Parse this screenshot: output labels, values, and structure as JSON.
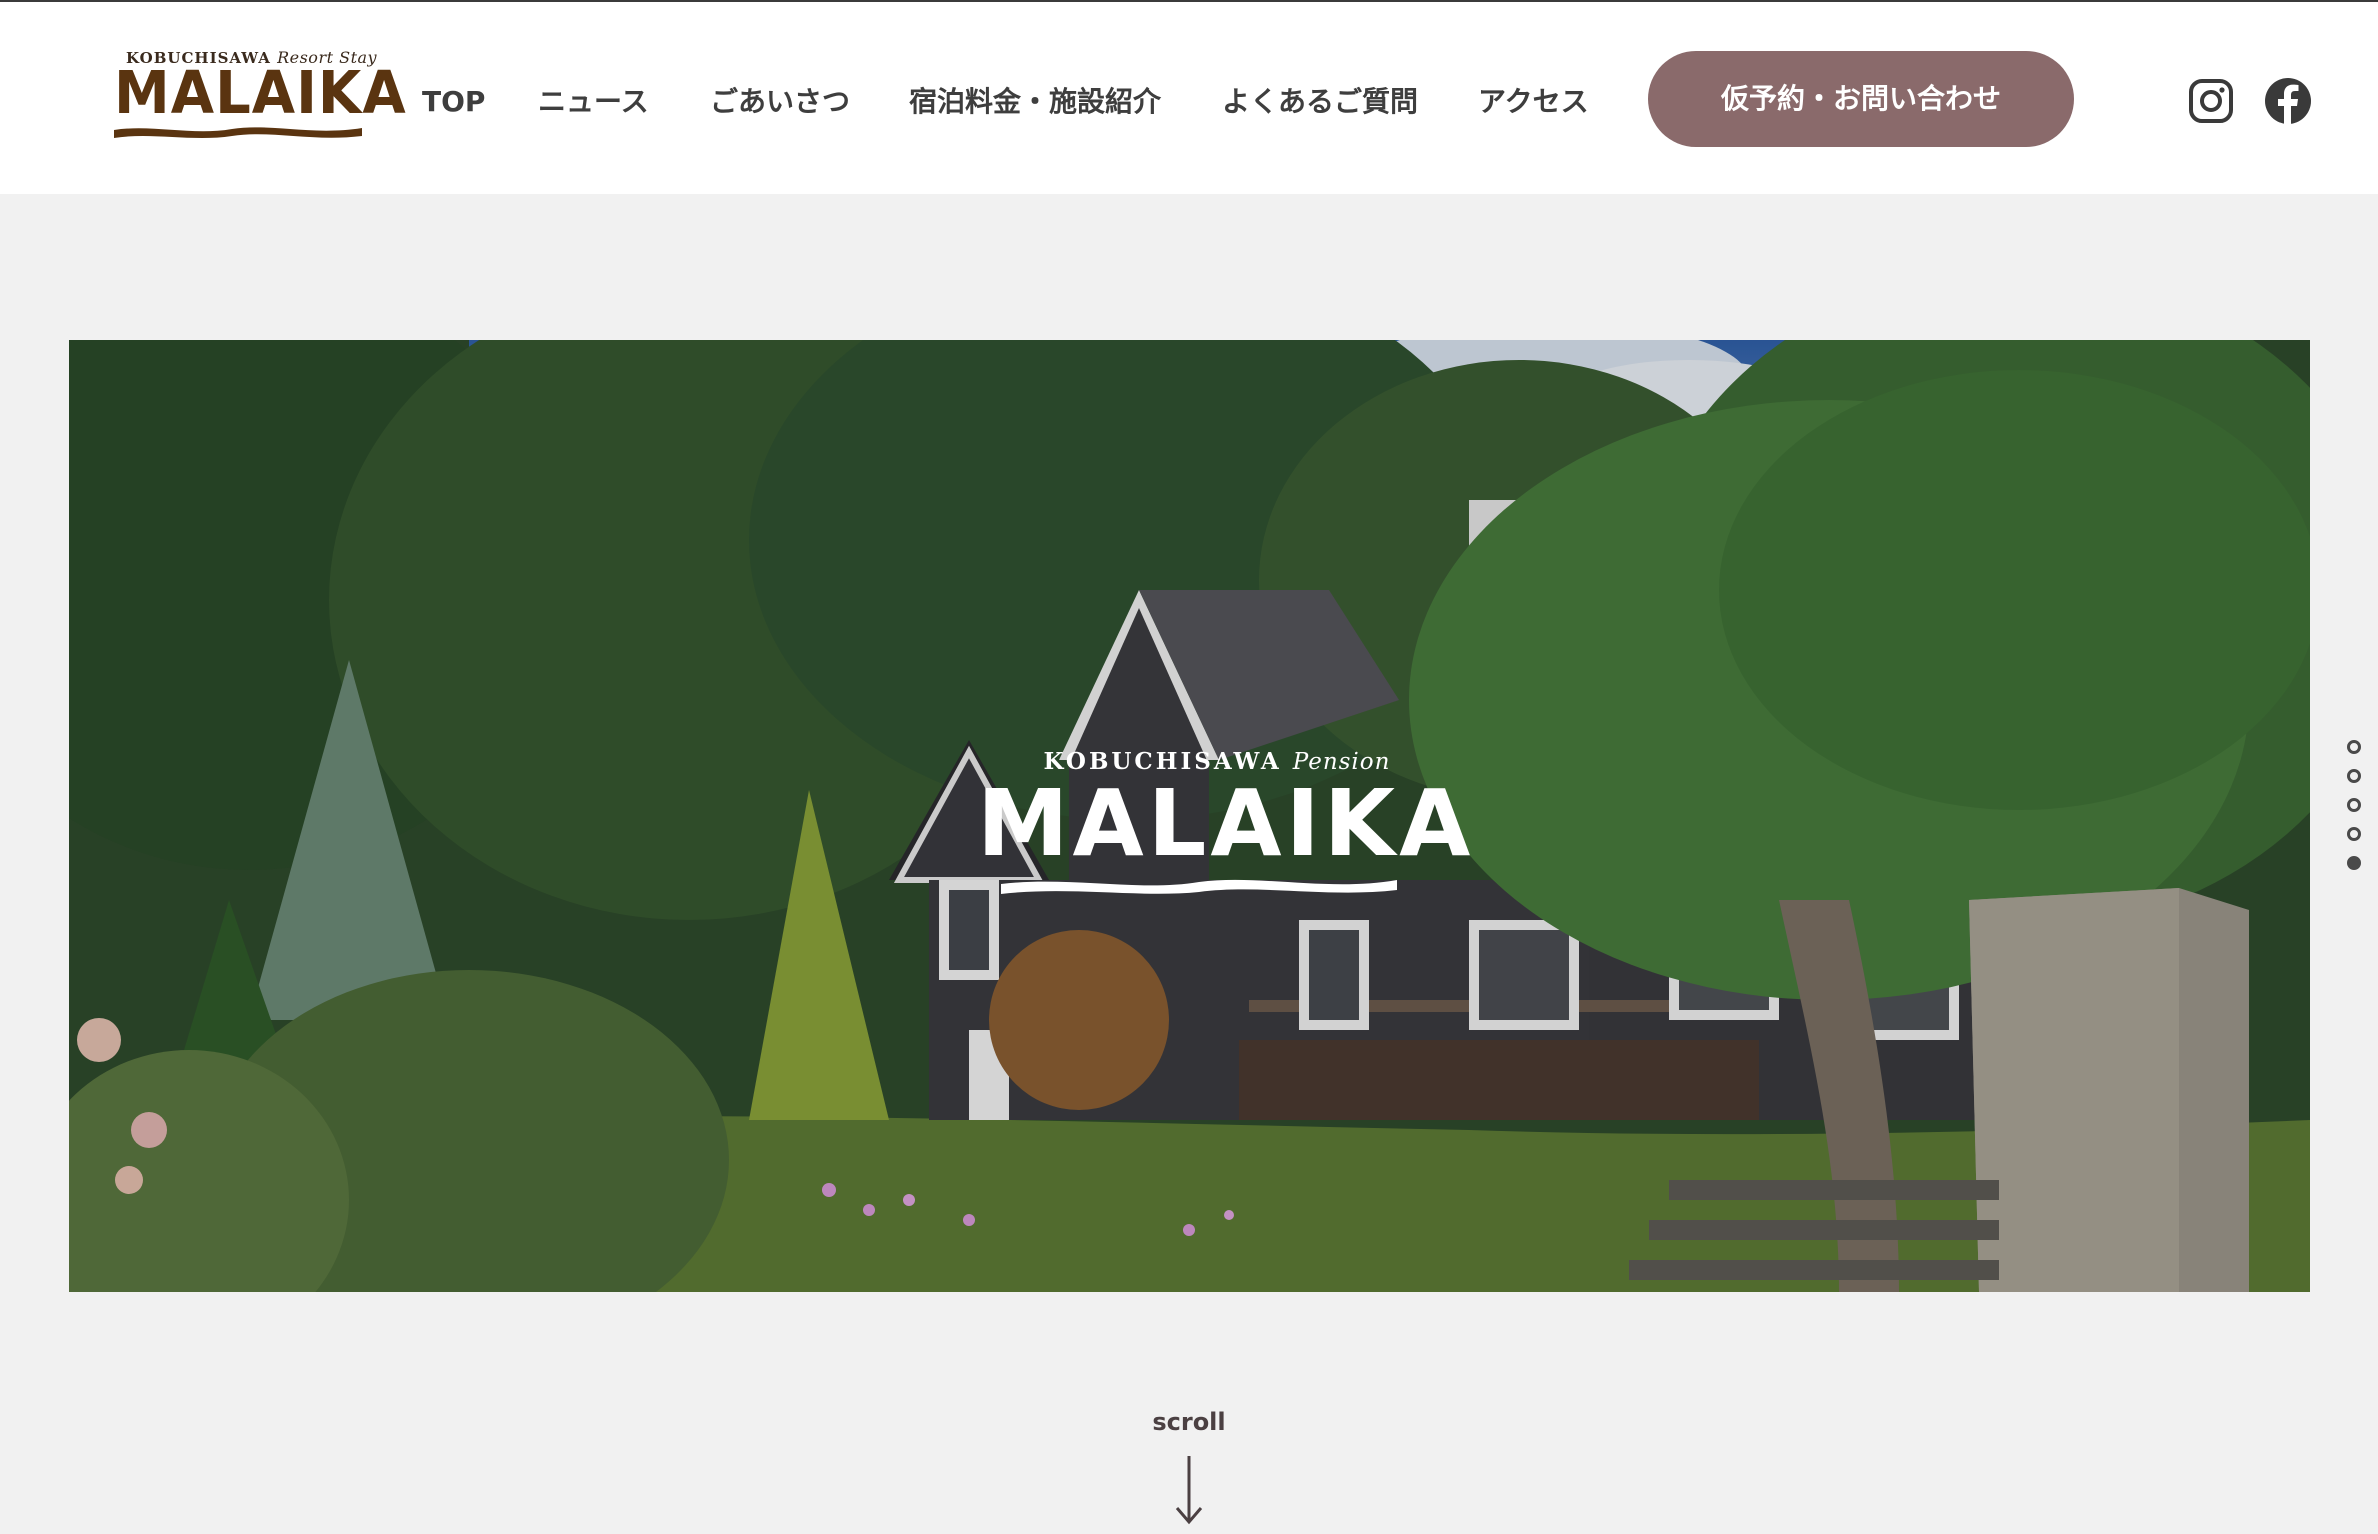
{
  "logo": {
    "small_text": "KOBUCHISAWA",
    "small_script": "Resort Stay",
    "main_text": "MALAIKA"
  },
  "nav": {
    "items": [
      {
        "label": "TOP"
      },
      {
        "label": "ニュース"
      },
      {
        "label": "ごあいさつ"
      },
      {
        "label": "宿泊料金・施設紹介"
      },
      {
        "label": "よくあるご質問"
      },
      {
        "label": "アクセス"
      }
    ],
    "cta_label": "仮予約・お問い合わせ"
  },
  "social": {
    "icons": [
      "instagram-icon",
      "facebook-icon"
    ]
  },
  "hero": {
    "logo_small_text": "KOBUCHISAWA",
    "logo_small_script": "Pension",
    "logo_main_text": "MALAIKA"
  },
  "slider": {
    "total_slides": 5,
    "active_slide": 5
  },
  "scroll": {
    "label": "scroll"
  },
  "colors": {
    "accent": "#8a6a6b",
    "logo_brown": "#5a3410",
    "background": "#f1f1f1",
    "header_bg": "#ffffff"
  }
}
